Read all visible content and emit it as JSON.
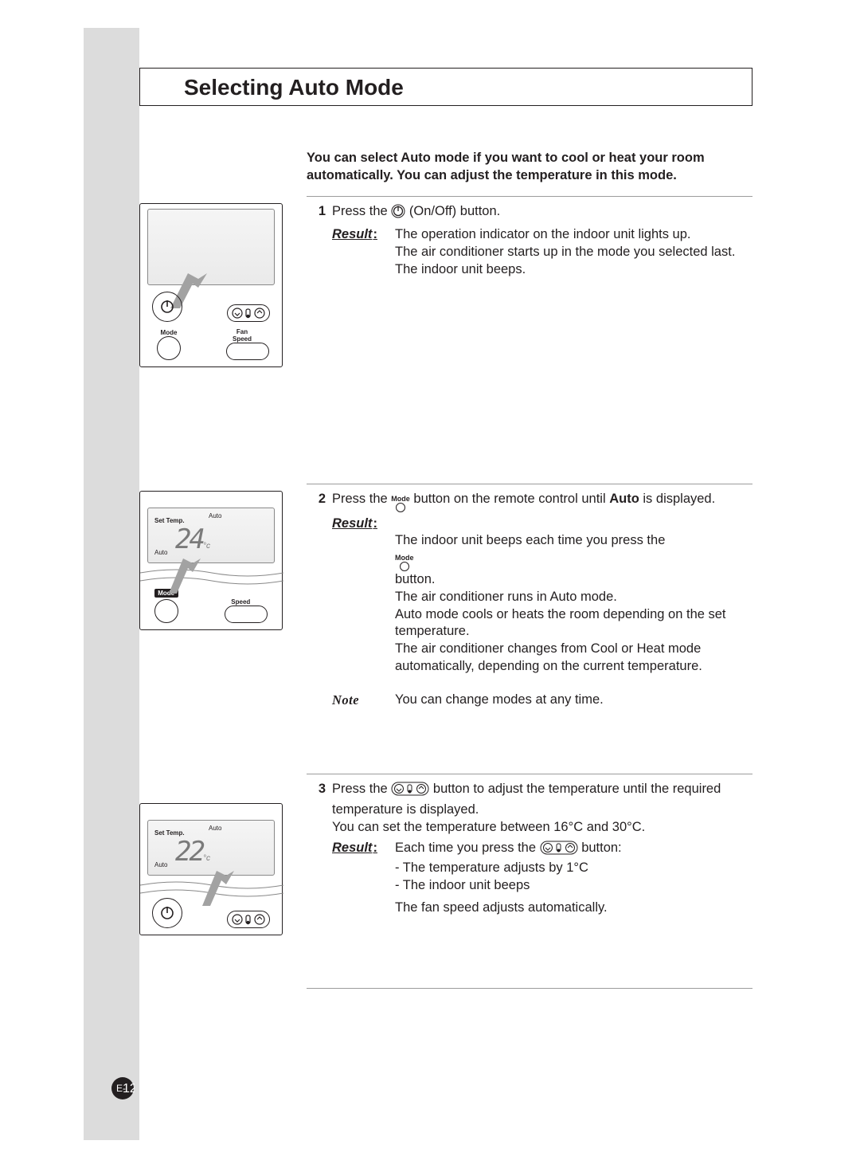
{
  "heading": "Selecting Auto Mode",
  "intro": "You can select Auto mode if you want to cool or heat your room automatically. You can adjust the temperature in this mode.",
  "step1": {
    "n": "1",
    "text_a": "Press the ",
    "text_b": " (On/Off) button.",
    "result": "The operation indicator on the indoor unit lights up.\nThe air conditioner starts up in the mode you selected last.\nThe indoor unit beeps."
  },
  "step2": {
    "n": "2",
    "text_a": "Press the ",
    "text_b": " button on the remote control until ",
    "text_c": "Auto",
    "text_d": " is displayed.",
    "result_a": "The indoor unit beeps each time you press the ",
    "result_b": " button.\nThe air conditioner runs in Auto mode.\nAuto mode cools or heats the room depending on the set temperature.\nThe air conditioner changes from Cool or Heat mode automatically, depending on the current temperature.",
    "note": "You can change modes at any time."
  },
  "step3": {
    "n": "3",
    "text_a": "Press the ",
    "text_b": " button to adjust the temperature until the required temperature is displayed.",
    "range": "You can set the temperature between 16°C and 30°C.",
    "result_a": "Each time you press the ",
    "result_b": " button:\n- The temperature adjusts by 1°C\n- The indoor unit beeps",
    "result_c": "The fan speed adjusts automatically."
  },
  "labels": {
    "result": "Result",
    "note": "Note",
    "mode": "Mode",
    "fan_speed": "Fan Speed",
    "set_temp": "Set Temp.",
    "auto": "Auto",
    "speed": "Speed"
  },
  "remote2": {
    "temp": "24",
    "unit": "°c"
  },
  "remote3": {
    "temp": "22",
    "unit": "°c"
  },
  "page": {
    "prefix": "E-",
    "num": "12"
  }
}
